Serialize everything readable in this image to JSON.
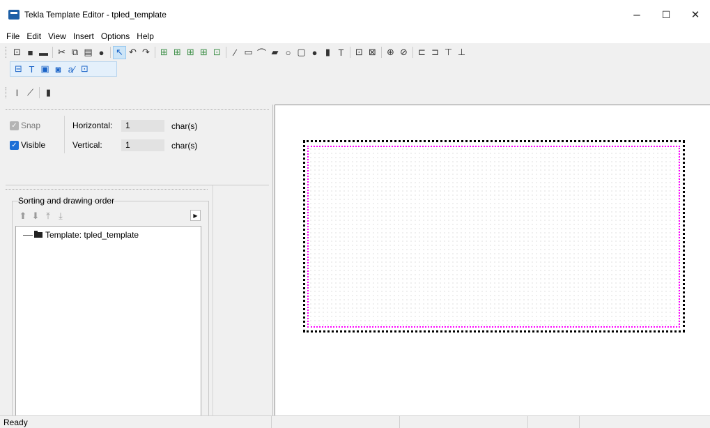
{
  "window": {
    "title": "Tekla Template Editor - tpled_template",
    "minimize": "–",
    "maximize": "☐",
    "close": "✕"
  },
  "menu": [
    "File",
    "Edit",
    "View",
    "Insert",
    "Options",
    "Help"
  ],
  "toolbar_main": [
    {
      "name": "new-icon",
      "glyph": "⊡"
    },
    {
      "name": "open-icon",
      "glyph": "■"
    },
    {
      "name": "save-icon",
      "glyph": "▬"
    },
    {
      "sep": true
    },
    {
      "name": "cut-icon",
      "glyph": "✂"
    },
    {
      "name": "copy-icon",
      "glyph": "⧉"
    },
    {
      "name": "paste-icon",
      "glyph": "▤"
    },
    {
      "name": "delete-icon",
      "glyph": "●"
    },
    {
      "sep": true
    },
    {
      "name": "pointer-icon",
      "glyph": "↖",
      "selected": true
    },
    {
      "name": "undo-icon",
      "glyph": "↶"
    },
    {
      "name": "redo-icon",
      "glyph": "↷"
    },
    {
      "sep": true
    },
    {
      "name": "header-row-icon",
      "glyph": "⊞",
      "color": "green"
    },
    {
      "name": "page-header-icon",
      "glyph": "⊞",
      "color": "green"
    },
    {
      "name": "data-row-icon",
      "glyph": "⊞",
      "color": "green"
    },
    {
      "name": "page-footer-icon",
      "glyph": "⊞",
      "color": "green"
    },
    {
      "name": "footer-row-icon",
      "glyph": "⊡",
      "color": "green"
    },
    {
      "sep": true
    },
    {
      "name": "line-icon",
      "glyph": "∕"
    },
    {
      "name": "rectangle-icon",
      "glyph": "▭"
    },
    {
      "name": "arc-icon",
      "glyph": "⌒"
    },
    {
      "name": "polyline-icon",
      "glyph": "▰"
    },
    {
      "name": "circle-icon",
      "glyph": "○"
    },
    {
      "name": "frame-icon",
      "glyph": "▢"
    },
    {
      "name": "point-icon",
      "glyph": "●"
    },
    {
      "name": "fill-icon",
      "glyph": "▮"
    },
    {
      "name": "text-icon",
      "glyph": "T"
    },
    {
      "sep": true
    },
    {
      "name": "zoom-icon",
      "glyph": "⊡"
    },
    {
      "name": "zoom-window-icon",
      "glyph": "⊠"
    },
    {
      "sep": true
    },
    {
      "name": "value-field-icon",
      "glyph": "⊕"
    },
    {
      "name": "formula-icon",
      "glyph": "⊘"
    },
    {
      "sep": true
    },
    {
      "name": "align-left-icon",
      "glyph": "⊏"
    },
    {
      "name": "align-right-icon",
      "glyph": "⊐"
    },
    {
      "name": "align-top-icon",
      "glyph": "⊤"
    },
    {
      "name": "align-bottom-icon",
      "glyph": "⊥"
    }
  ],
  "toolbar_insert": [
    {
      "name": "symbol-icon",
      "glyph": "⊟"
    },
    {
      "name": "text-insert-icon",
      "glyph": "T"
    },
    {
      "name": "picture-icon",
      "glyph": "▣"
    },
    {
      "name": "field-icon",
      "glyph": "◙"
    },
    {
      "name": "attribute-icon",
      "glyph": "a⁄"
    },
    {
      "name": "grid-insert-icon",
      "glyph": "⊡"
    }
  ],
  "toolbar_draw": [
    {
      "name": "vertical-line-icon",
      "glyph": "ǀ"
    },
    {
      "name": "angled-line-icon",
      "glyph": "⟋"
    },
    {
      "sep": true
    },
    {
      "name": "bar-icon",
      "glyph": "▮"
    }
  ],
  "snap_panel": {
    "snap_label": "Snap",
    "visible_label": "Visible",
    "horizontal_label": "Horizontal:",
    "horizontal_value": "1",
    "horizontal_unit": "char(s)",
    "vertical_label": "Vertical:",
    "vertical_value": "1",
    "vertical_unit": "char(s)",
    "snap_checked": true,
    "visible_checked": true
  },
  "sorting": {
    "title": "Sorting and drawing order",
    "buttons": [
      {
        "name": "move-up-icon",
        "glyph": "⬆"
      },
      {
        "name": "move-down-icon",
        "glyph": "⬇"
      },
      {
        "name": "move-top-icon",
        "glyph": "⤒"
      },
      {
        "name": "move-bottom-icon",
        "glyph": "⤓"
      }
    ],
    "expand_glyph": "▶",
    "tree_item": "Template: tpled_template"
  },
  "status": {
    "text": "Ready"
  }
}
